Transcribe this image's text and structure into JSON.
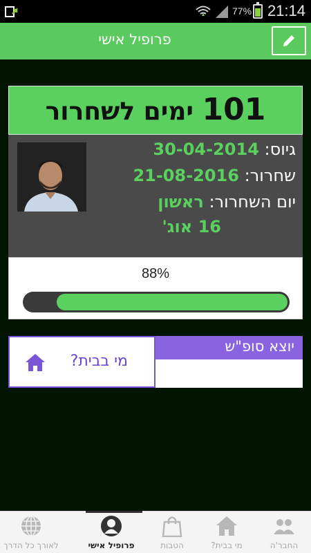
{
  "status_bar": {
    "battery_percent": "77%",
    "battery_level": 0.77,
    "time": "21:14",
    "icons": [
      "app-update-icon",
      "wifi-icon",
      "signal-icon",
      "battery-icon"
    ]
  },
  "action_bar": {
    "title": "פרופיל אישי",
    "edit_icon": "pencil-icon"
  },
  "countdown": {
    "number": "101",
    "text": "ימים לשחרור"
  },
  "profile": {
    "enlist_label": "גיוס:",
    "enlist_date": "30-04-2014",
    "release_label": "שחרור:",
    "release_date": "21-08-2016",
    "release_day_label": "יום השחרור:",
    "release_day": "ראשון",
    "release_short_date": "16 אוג'"
  },
  "progress": {
    "label": "88%",
    "value": 0.88
  },
  "weekend": {
    "title": "יוצא סופ\"ש"
  },
  "home_button": {
    "label": "מי בבית?",
    "icon": "home-icon"
  },
  "bottom_nav": {
    "active_index": 1,
    "items": [
      {
        "label": "לאורך כל הדרך",
        "icon": "globe-icon"
      },
      {
        "label": "פרופיל אישי",
        "icon": "profile-icon"
      },
      {
        "label": "הטבות",
        "icon": "shopping-bag-icon"
      },
      {
        "label": "מי בבית?",
        "icon": "home-icon"
      },
      {
        "label": "החבר'ה",
        "icon": "friends-icon"
      }
    ]
  },
  "colors": {
    "accent_green": "#5ad05e",
    "purple": "#8a64e0",
    "background": "#001400"
  }
}
